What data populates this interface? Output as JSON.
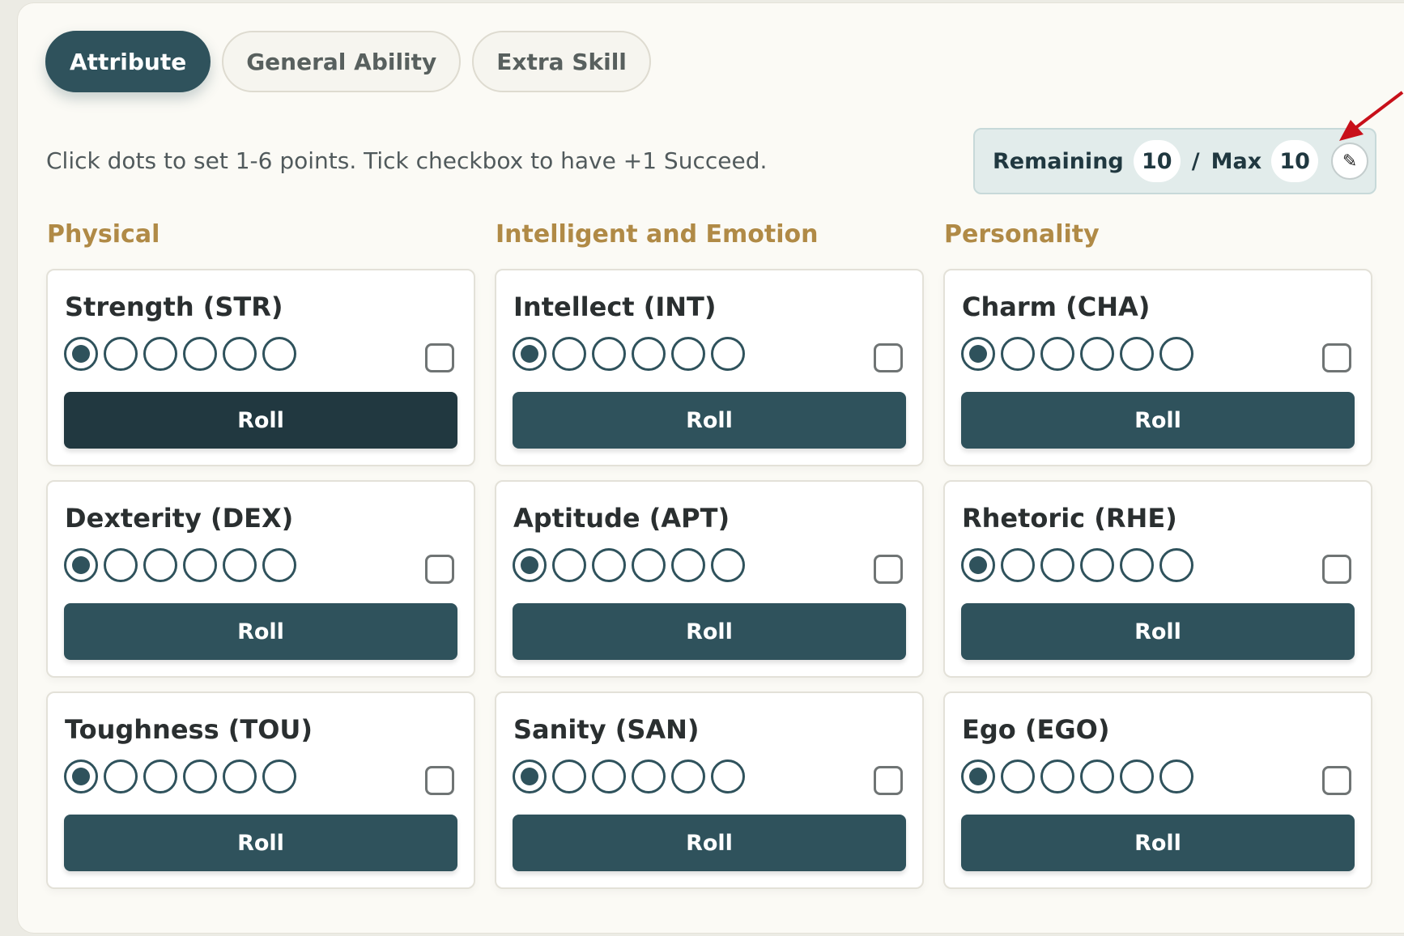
{
  "tabs": [
    {
      "label": "Attribute",
      "active": true
    },
    {
      "label": "General Ability",
      "active": false
    },
    {
      "label": "Extra Skill",
      "active": false
    }
  ],
  "hint": "Click dots to set 1-6 points. Tick checkbox to have +1 Succeed.",
  "points": {
    "remaining_label": "Remaining",
    "remaining": "10",
    "separator": "/",
    "max_label": "Max",
    "max": "10",
    "edit_icon": "pencil-icon"
  },
  "roll_label": "Roll",
  "colors": {
    "primary": "#2f525c",
    "primary_hover": "#213840",
    "section_heading": "#b08a46",
    "panel": "#fbfaf5",
    "annotation_arrow": "#c8101a"
  },
  "columns": [
    {
      "title": "Physical",
      "attributes": [
        {
          "name": "Strength (STR)",
          "points": 1,
          "max_points": 6,
          "succeed_checked": false
        },
        {
          "name": "Dexterity (DEX)",
          "points": 1,
          "max_points": 6,
          "succeed_checked": false
        },
        {
          "name": "Toughness (TOU)",
          "points": 1,
          "max_points": 6,
          "succeed_checked": false
        }
      ]
    },
    {
      "title": "Intelligent and Emotion",
      "attributes": [
        {
          "name": "Intellect (INT)",
          "points": 1,
          "max_points": 6,
          "succeed_checked": false
        },
        {
          "name": "Aptitude (APT)",
          "points": 1,
          "max_points": 6,
          "succeed_checked": false
        },
        {
          "name": "Sanity (SAN)",
          "points": 1,
          "max_points": 6,
          "succeed_checked": false
        }
      ]
    },
    {
      "title": "Personality",
      "attributes": [
        {
          "name": "Charm (CHA)",
          "points": 1,
          "max_points": 6,
          "succeed_checked": false
        },
        {
          "name": "Rhetoric (RHE)",
          "points": 1,
          "max_points": 6,
          "succeed_checked": false
        },
        {
          "name": "Ego (EGO)",
          "points": 1,
          "max_points": 6,
          "succeed_checked": false
        }
      ]
    }
  ]
}
